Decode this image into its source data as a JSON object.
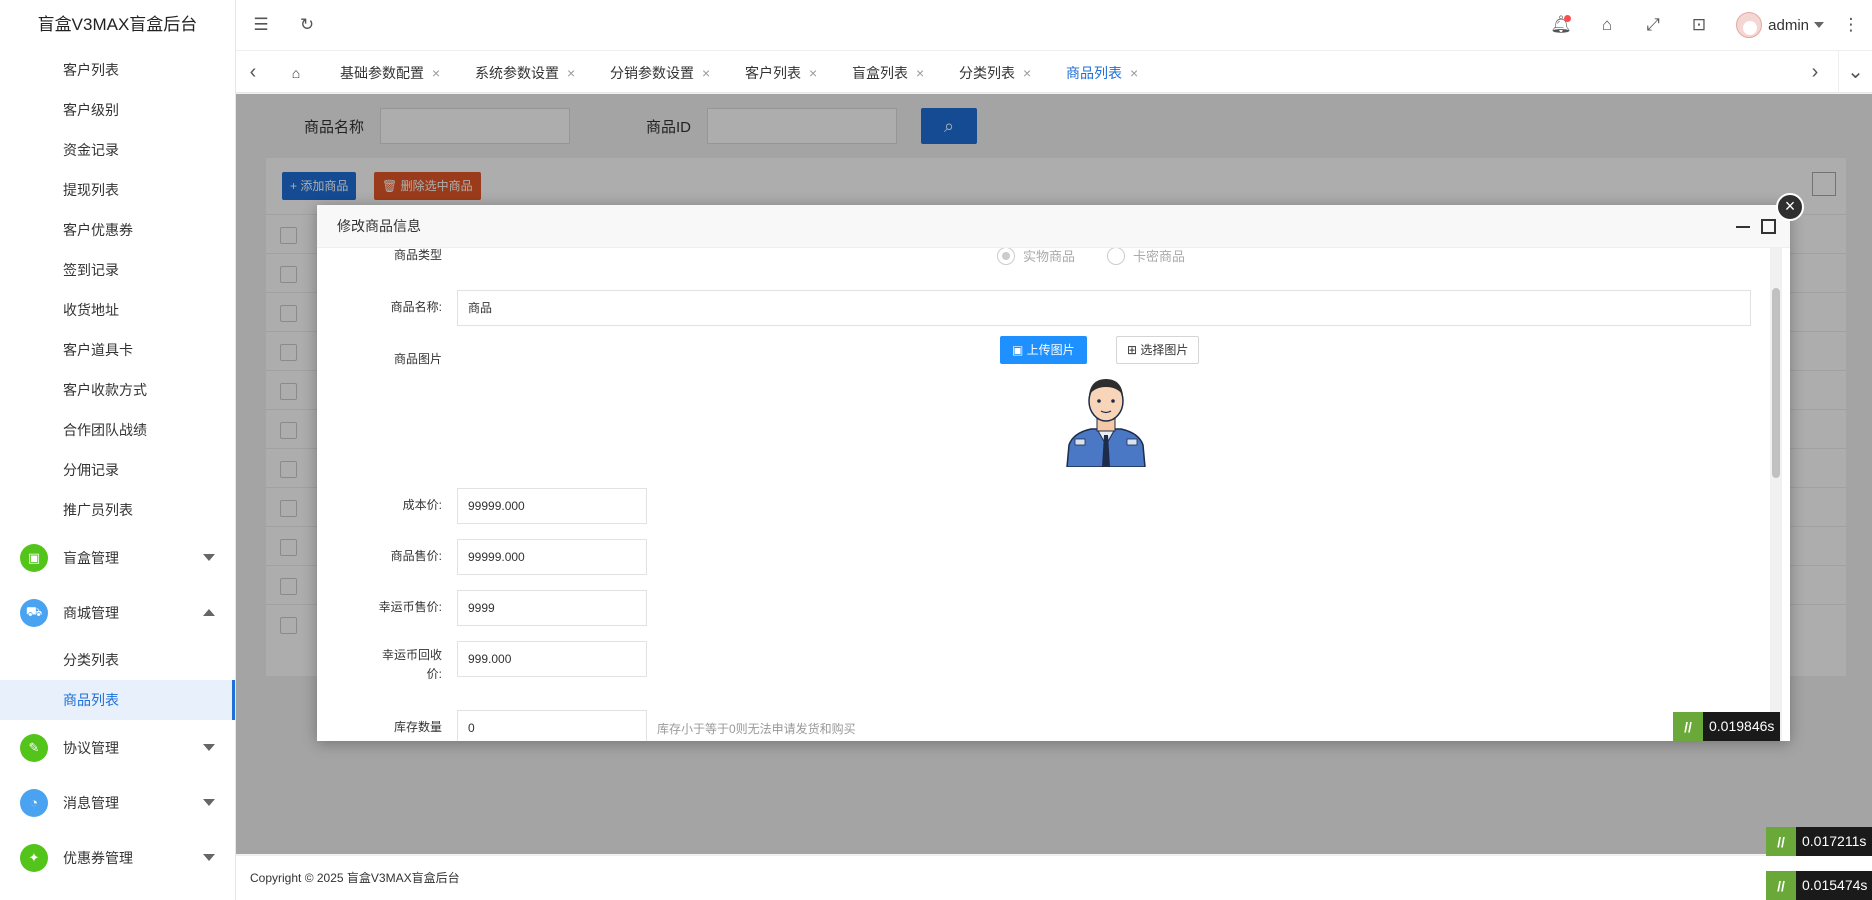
{
  "app_title": "盲盒V3MAX盲盒后台",
  "sidebar": {
    "sub_items_top": [
      "客户列表",
      "客户级别",
      "资金记录",
      "提现列表",
      "客户优惠券",
      "签到记录",
      "收货地址",
      "客户道具卡",
      "客户收款方式",
      "合作团队战绩",
      "分佣记录",
      "推广员列表"
    ],
    "groups": {
      "blindbox": {
        "label": "盲盒管理",
        "color": "#52c41a"
      },
      "mall": {
        "label": "商城管理",
        "color": "#4aa3f0"
      },
      "agreement": {
        "label": "协议管理",
        "color": "#52c41a"
      },
      "message": {
        "label": "消息管理",
        "color": "#4aa3f0"
      },
      "coupon": {
        "label": "优惠券管理",
        "color": "#52c41a"
      }
    },
    "mall_items": [
      "分类列表",
      "商品列表"
    ]
  },
  "header": {
    "username": "admin",
    "icons": [
      "menu-fold-icon",
      "refresh-icon",
      "bell-icon",
      "tag-icon",
      "fullscreen-icon",
      "lock-icon",
      "more-icon"
    ]
  },
  "tabs": [
    "基础参数配置",
    "系统参数设置",
    "分销参数设置",
    "客户列表",
    "盲盒列表",
    "分类列表",
    "商品列表"
  ],
  "search": {
    "name_label": "商品名称",
    "id_label": "商品ID"
  },
  "toolbar": {
    "add_label": "添加商品",
    "delete_label": "删除选中商品"
  },
  "footer": "Copyright © 2025 盲盒V3MAX盲盒后台",
  "modal": {
    "title": "修改商品信息",
    "type_label": "商品类型",
    "type_options": [
      "实物商品",
      "卡密商品"
    ],
    "name_label": "商品名称:",
    "name_value": "商品",
    "image_label": "商品图片",
    "upload_label": "上传图片",
    "select_label": "选择图片",
    "cost_label": "成本价:",
    "cost_value": "99999.000",
    "price_label": "商品售价:",
    "price_value": "99999.000",
    "lucky_price_label": "幸运币售价:",
    "lucky_price_value": "9999",
    "lucky_recycle_label": "幸运币回收价:",
    "lucky_recycle_value": "999.000",
    "stock_label": "库存数量",
    "stock_value": "0",
    "stock_hint": "库存小于等于0则无法申请发货和购买"
  },
  "timers": [
    "0.019846s",
    "0.017211s",
    "0.015474s"
  ]
}
